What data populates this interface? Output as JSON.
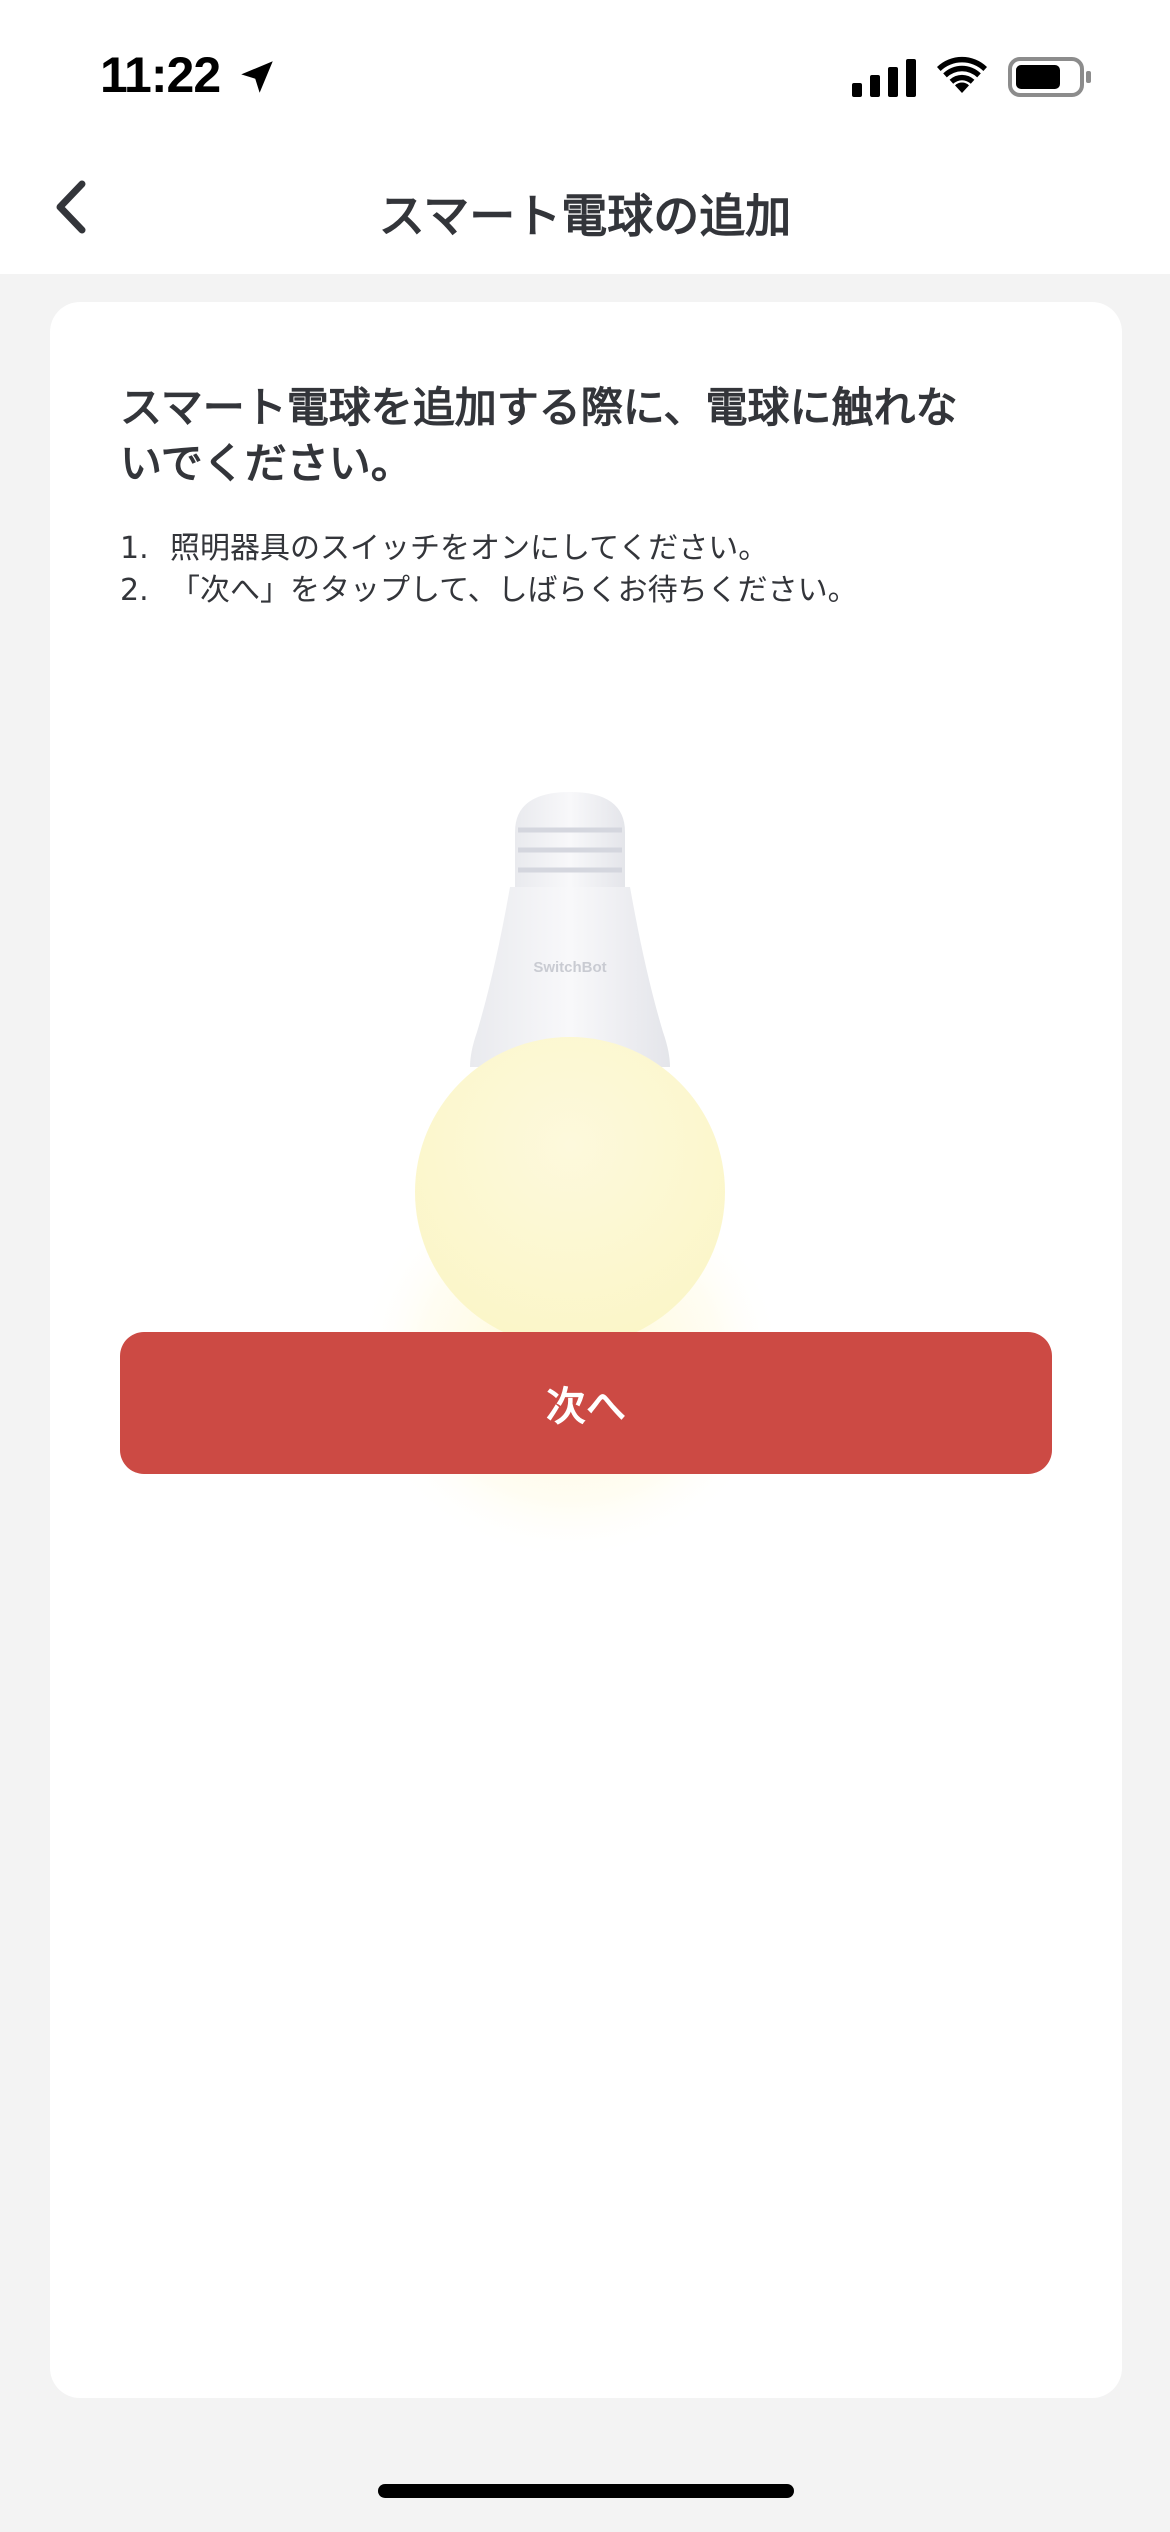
{
  "status_bar": {
    "time": "11:22",
    "icons": [
      "location-arrow-icon",
      "cellular-signal-icon",
      "wifi-icon",
      "battery-icon"
    ]
  },
  "nav": {
    "title": "スマート電球の追加",
    "back_icon": "chevron-left-icon"
  },
  "content": {
    "heading_lines": [
      "スマート電球を追加する際に、電球に触れな",
      "いでください。"
    ],
    "steps": [
      {
        "num": "1.",
        "text": "照明器具のスイッチをオンにしてください。"
      },
      {
        "num": "2.",
        "text": "「次へ」をタップして、しばらくお待ちください。"
      }
    ],
    "bulb_brand": "SwitchBot",
    "next_button_label": "次へ"
  },
  "colors": {
    "accent": "#cc4a44",
    "background": "#f3f3f3",
    "card": "#ffffff",
    "text": "#33353a"
  }
}
